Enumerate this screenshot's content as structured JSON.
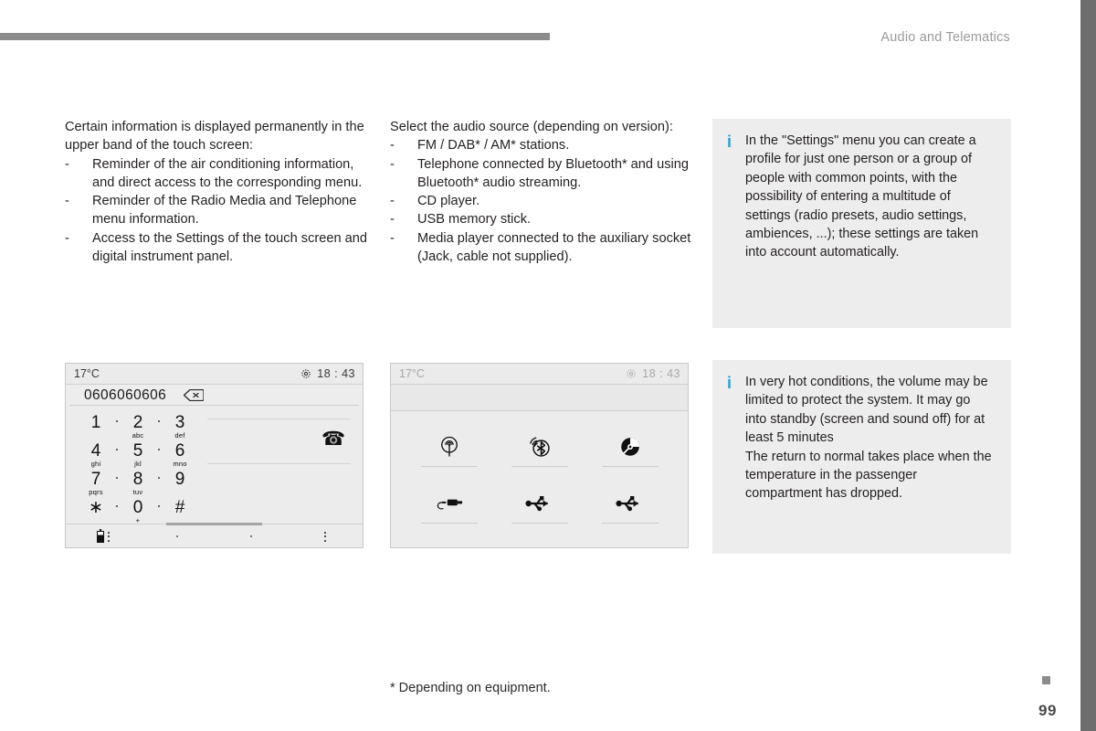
{
  "header": {
    "title": "Audio and Telematics"
  },
  "footer": {
    "footnote": "* Depending on equipment.",
    "page_number": "99"
  },
  "colors": {
    "header_rule": "#8c8c8c",
    "edge_bar": "#6e6e6e",
    "note_background": "#ededed",
    "note_accent": "#2e9fd4"
  },
  "column_left": {
    "intro": "Certain information is displayed permanently in the upper band of the touch screen:",
    "dash": "-",
    "items": [
      "Reminder of the air conditioning information, and direct access to the corresponding menu.",
      "Reminder of the Radio Media and Telephone menu information.",
      "Access to the Settings of the touch screen and digital instrument panel."
    ]
  },
  "column_middle": {
    "intro": "Select the audio source (depending on version):",
    "dash": "-",
    "items": [
      "FM / DAB* / AM* stations.",
      "Telephone connected by Bluetooth* and using Bluetooth* audio streaming.",
      "CD player.",
      "USB memory stick.",
      "Media player connected to the auxiliary socket (Jack, cable not supplied)."
    ]
  },
  "notes": [
    {
      "icon": "info-icon",
      "icon_glyph": "i",
      "text": "In the \"Settings\" menu you can create a profile for just one person or a group of people with common points, with the possibility of entering a multitude of settings (radio presets, audio settings, ambiences, ...); these settings are taken into account automatically."
    },
    {
      "icon": "info-icon",
      "icon_glyph": "i",
      "text_line_1": "In very hot conditions, the volume may be limited to protect the system. It may go into standby (screen and sound off) for at least 5 minutes",
      "text_line_2": "The return to normal takes place when the temperature in the passenger compartment has dropped."
    }
  ],
  "phone_screen": {
    "status": {
      "temperature": "17°C",
      "gear_icon": "gear-icon",
      "time": "18 : 43"
    },
    "dialled_number": "0606060606",
    "backspace_icon": "backspace-icon",
    "keys": [
      {
        "num": "1",
        "sub": ""
      },
      {
        "num": "2",
        "sub": "abc"
      },
      {
        "num": "3",
        "sub": "def"
      },
      {
        "num": "4",
        "sub": "ghi"
      },
      {
        "num": "5",
        "sub": "jkl"
      },
      {
        "num": "6",
        "sub": "mno"
      },
      {
        "num": "7",
        "sub": "pqrs"
      },
      {
        "num": "8",
        "sub": "tuv"
      },
      {
        "num": "9",
        "sub": ""
      },
      {
        "num": "∗",
        "sub": ""
      },
      {
        "num": "0",
        "sub": "+"
      },
      {
        "num": "#",
        "sub": ""
      }
    ],
    "call_icon": "call-handset-icon",
    "bottom_bar": {
      "items": [
        {
          "icon": "battery-icon",
          "secondary_icon": "kebab-menu-icon"
        },
        {
          "icon": "dot-icon"
        },
        {
          "icon": "dot-icon"
        },
        {
          "icon": "kebab-menu-icon"
        }
      ]
    }
  },
  "sources_screen": {
    "status": {
      "temperature": "17°C",
      "gear_icon": "gear-icon",
      "time": "18 : 43"
    },
    "sources": [
      {
        "icon": "radio-antenna-icon",
        "label": ""
      },
      {
        "icon": "bluetooth-streaming-icon",
        "label": ""
      },
      {
        "icon": "cd-disc-icon",
        "label": ""
      },
      {
        "icon": "aux-jack-icon",
        "label": ""
      },
      {
        "icon": "usb-icon",
        "label": ""
      },
      {
        "icon": "usb-icon",
        "label": ""
      }
    ]
  }
}
